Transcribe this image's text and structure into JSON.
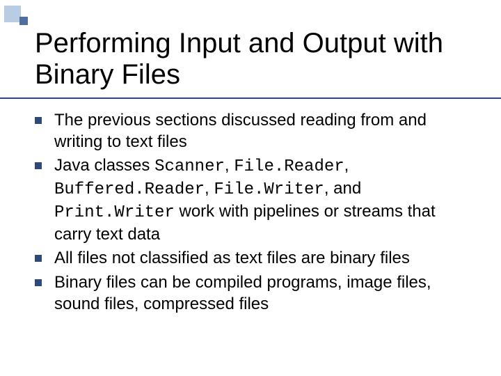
{
  "title": "Performing Input and Output with Binary Files",
  "bullets": {
    "b1": "The previous sections discussed reading from and writing to text files",
    "b2": {
      "p1": "Java classes ",
      "c1": "Scanner",
      "p2": ", ",
      "c2": "File.Reader",
      "p3": ", ",
      "c3": "Buffered.Reader",
      "p4": ", ",
      "c4": "File.Writer",
      "p5": ", and ",
      "c5": "Print.Writer",
      "p6": " work with pipelines or streams that carry text data"
    },
    "b3": "All files not classified as text files are binary files",
    "b4": "Binary files can be compiled programs, image files, sound files, compressed files"
  }
}
